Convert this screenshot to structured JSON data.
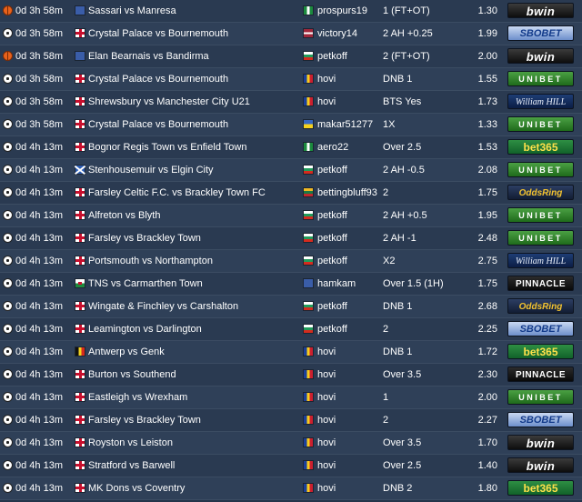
{
  "tips": [
    {
      "sport": "basketball",
      "time": "0d 3h 58m",
      "match_flag": "gen",
      "match": "Sassari vs Manresa",
      "tipster_flag": "nga",
      "tipster": "prospurs19",
      "pick": "1 (FT+OT)",
      "odds": "1.30",
      "bookmaker": "bwin",
      "book_style": "bwin"
    },
    {
      "sport": "football",
      "time": "0d 3h 58m",
      "match_flag": "eng",
      "match": "Crystal Palace vs Bournemouth",
      "tipster_flag": "lva",
      "tipster": "victory14",
      "pick": "2 AH +0.25",
      "odds": "1.99",
      "bookmaker": "SBOBET",
      "book_style": "sbobet"
    },
    {
      "sport": "basketball",
      "time": "0d 3h 58m",
      "match_flag": "gen",
      "match": "Elan Bearnais vs Bandirma",
      "tipster_flag": "bul",
      "tipster": "petkoff",
      "pick": "2 (FT+OT)",
      "odds": "2.00",
      "bookmaker": "bwin",
      "book_style": "bwin"
    },
    {
      "sport": "football",
      "time": "0d 3h 58m",
      "match_flag": "eng",
      "match": "Crystal Palace vs Bournemouth",
      "tipster_flag": "rou",
      "tipster": "hovi",
      "pick": "DNB 1",
      "odds": "1.55",
      "bookmaker": "UNIBET",
      "book_style": "unibet"
    },
    {
      "sport": "football",
      "time": "0d 3h 58m",
      "match_flag": "eng",
      "match": "Shrewsbury vs Manchester City U21",
      "tipster_flag": "rou",
      "tipster": "hovi",
      "pick": "BTS Yes",
      "odds": "1.73",
      "bookmaker": "William HILL",
      "book_style": "williamhill"
    },
    {
      "sport": "football",
      "time": "0d 3h 58m",
      "match_flag": "eng",
      "match": "Crystal Palace vs Bournemouth",
      "tipster_flag": "ukr",
      "tipster": "makar51277",
      "pick": "1X",
      "odds": "1.33",
      "bookmaker": "UNIBET",
      "book_style": "unibet"
    },
    {
      "sport": "football",
      "time": "0d 4h 13m",
      "match_flag": "eng",
      "match": "Bognor Regis Town vs Enfield Town",
      "tipster_flag": "nga",
      "tipster": "aero22",
      "pick": "Over 2.5",
      "odds": "1.53",
      "bookmaker": "bet365",
      "book_style": "bet365"
    },
    {
      "sport": "football",
      "time": "0d 4h 13m",
      "match_flag": "sco",
      "match": "Stenhousemuir vs Elgin City",
      "tipster_flag": "bul",
      "tipster": "petkoff",
      "pick": "2 AH -0.5",
      "odds": "2.08",
      "bookmaker": "UNIBET",
      "book_style": "unibet"
    },
    {
      "sport": "football",
      "time": "0d 4h 13m",
      "match_flag": "eng",
      "match": "Farsley Celtic F.C. vs Brackley Town FC",
      "tipster_flag": "ltu",
      "tipster": "bettingbluff93",
      "pick": "2",
      "odds": "1.75",
      "bookmaker": "OddsRing",
      "book_style": "oddsring"
    },
    {
      "sport": "football",
      "time": "0d 4h 13m",
      "match_flag": "eng",
      "match": "Alfreton vs Blyth",
      "tipster_flag": "bul",
      "tipster": "petkoff",
      "pick": "2 AH +0.5",
      "odds": "1.95",
      "bookmaker": "UNIBET",
      "book_style": "unibet"
    },
    {
      "sport": "football",
      "time": "0d 4h 13m",
      "match_flag": "eng",
      "match": "Farsley vs Brackley Town",
      "tipster_flag": "bul",
      "tipster": "petkoff",
      "pick": "2 AH -1",
      "odds": "2.48",
      "bookmaker": "UNIBET",
      "book_style": "unibet"
    },
    {
      "sport": "football",
      "time": "0d 4h 13m",
      "match_flag": "eng",
      "match": "Portsmouth vs Northampton",
      "tipster_flag": "bul",
      "tipster": "petkoff",
      "pick": "X2",
      "odds": "2.75",
      "bookmaker": "William HILL",
      "book_style": "williamhill"
    },
    {
      "sport": "football",
      "time": "0d 4h 13m",
      "match_flag": "wal",
      "match": "TNS vs Carmarthen Town",
      "tipster_flag": "gen",
      "tipster": "hamkam",
      "pick": "Over 1.5 (1H)",
      "odds": "1.75",
      "bookmaker": "PINNACLE",
      "book_style": "pinnacle"
    },
    {
      "sport": "football",
      "time": "0d 4h 13m",
      "match_flag": "eng",
      "match": "Wingate & Finchley vs Carshalton",
      "tipster_flag": "bul",
      "tipster": "petkoff",
      "pick": "DNB 1",
      "odds": "2.68",
      "bookmaker": "OddsRing",
      "book_style": "oddsring"
    },
    {
      "sport": "football",
      "time": "0d 4h 13m",
      "match_flag": "eng",
      "match": "Leamington vs Darlington",
      "tipster_flag": "bul",
      "tipster": "petkoff",
      "pick": "2",
      "odds": "2.25",
      "bookmaker": "SBOBET",
      "book_style": "sbobet"
    },
    {
      "sport": "football",
      "time": "0d 4h 13m",
      "match_flag": "bel",
      "match": "Antwerp vs Genk",
      "tipster_flag": "rou",
      "tipster": "hovi",
      "pick": "DNB 1",
      "odds": "1.72",
      "bookmaker": "bet365",
      "book_style": "bet365"
    },
    {
      "sport": "football",
      "time": "0d 4h 13m",
      "match_flag": "eng",
      "match": "Burton vs Southend",
      "tipster_flag": "rou",
      "tipster": "hovi",
      "pick": "Over 3.5",
      "odds": "2.30",
      "bookmaker": "PINNACLE",
      "book_style": "pinnacle"
    },
    {
      "sport": "football",
      "time": "0d 4h 13m",
      "match_flag": "eng",
      "match": "Eastleigh vs Wrexham",
      "tipster_flag": "rou",
      "tipster": "hovi",
      "pick": "1",
      "odds": "2.00",
      "bookmaker": "UNIBET",
      "book_style": "unibet"
    },
    {
      "sport": "football",
      "time": "0d 4h 13m",
      "match_flag": "eng",
      "match": "Farsley vs Brackley Town",
      "tipster_flag": "rou",
      "tipster": "hovi",
      "pick": "2",
      "odds": "2.27",
      "bookmaker": "SBOBET",
      "book_style": "sbobet"
    },
    {
      "sport": "football",
      "time": "0d 4h 13m",
      "match_flag": "eng",
      "match": "Royston vs Leiston",
      "tipster_flag": "rou",
      "tipster": "hovi",
      "pick": "Over 3.5",
      "odds": "1.70",
      "bookmaker": "bwin",
      "book_style": "bwin"
    },
    {
      "sport": "football",
      "time": "0d 4h 13m",
      "match_flag": "eng",
      "match": "Stratford vs Barwell",
      "tipster_flag": "rou",
      "tipster": "hovi",
      "pick": "Over 2.5",
      "odds": "1.40",
      "bookmaker": "bwin",
      "book_style": "bwin"
    },
    {
      "sport": "football",
      "time": "0d 4h 13m",
      "match_flag": "eng",
      "match": "MK Dons vs Coventry",
      "tipster_flag": "rou",
      "tipster": "hovi",
      "pick": "DNB 2",
      "odds": "1.80",
      "bookmaker": "bet365",
      "book_style": "bet365"
    }
  ]
}
